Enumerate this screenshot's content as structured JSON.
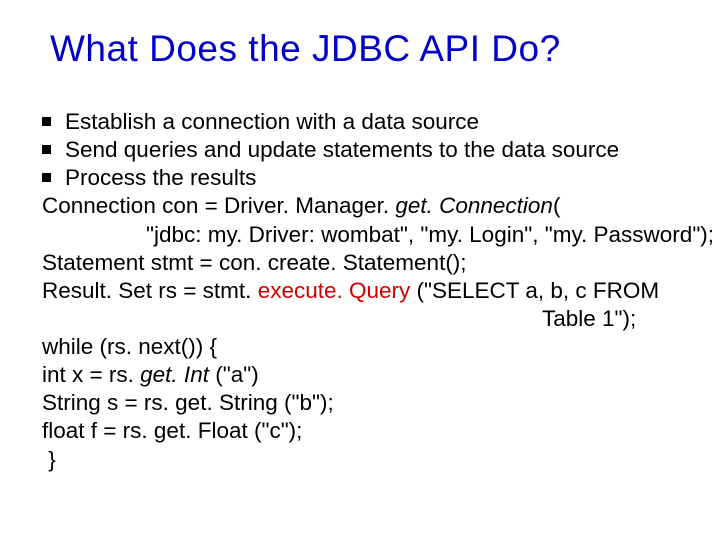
{
  "title": "What Does the JDBC API Do?",
  "bullets": [
    "Establish a connection with a data source",
    " Send queries and update statements to the data source",
    "Process the results"
  ],
  "code": {
    "l1_a": "Connection con = Driver. Manager. ",
    "l1_b": "get. Connection",
    "l1_c": "(",
    "l2": "\"jdbc: my. Driver: wombat\", \"my. Login\", \"my. Password\");",
    "l3": "Statement stmt = con. create. Statement();",
    "l4_a": "Result. Set rs = stmt. ",
    "l4_b": "execute. Query ",
    "l4_c": "(\"SELECT a, b, c FROM",
    "l5": "Table 1\");",
    "l6": "while (rs. next()) {",
    "l7_a": "int x = rs. ",
    "l7_b": "get. Int ",
    "l7_c": "(\"a\")",
    "l8": "String s = rs. get. String (\"b\");",
    "l9": "float f = rs. get. Float (\"c\");",
    "l10": " }"
  }
}
